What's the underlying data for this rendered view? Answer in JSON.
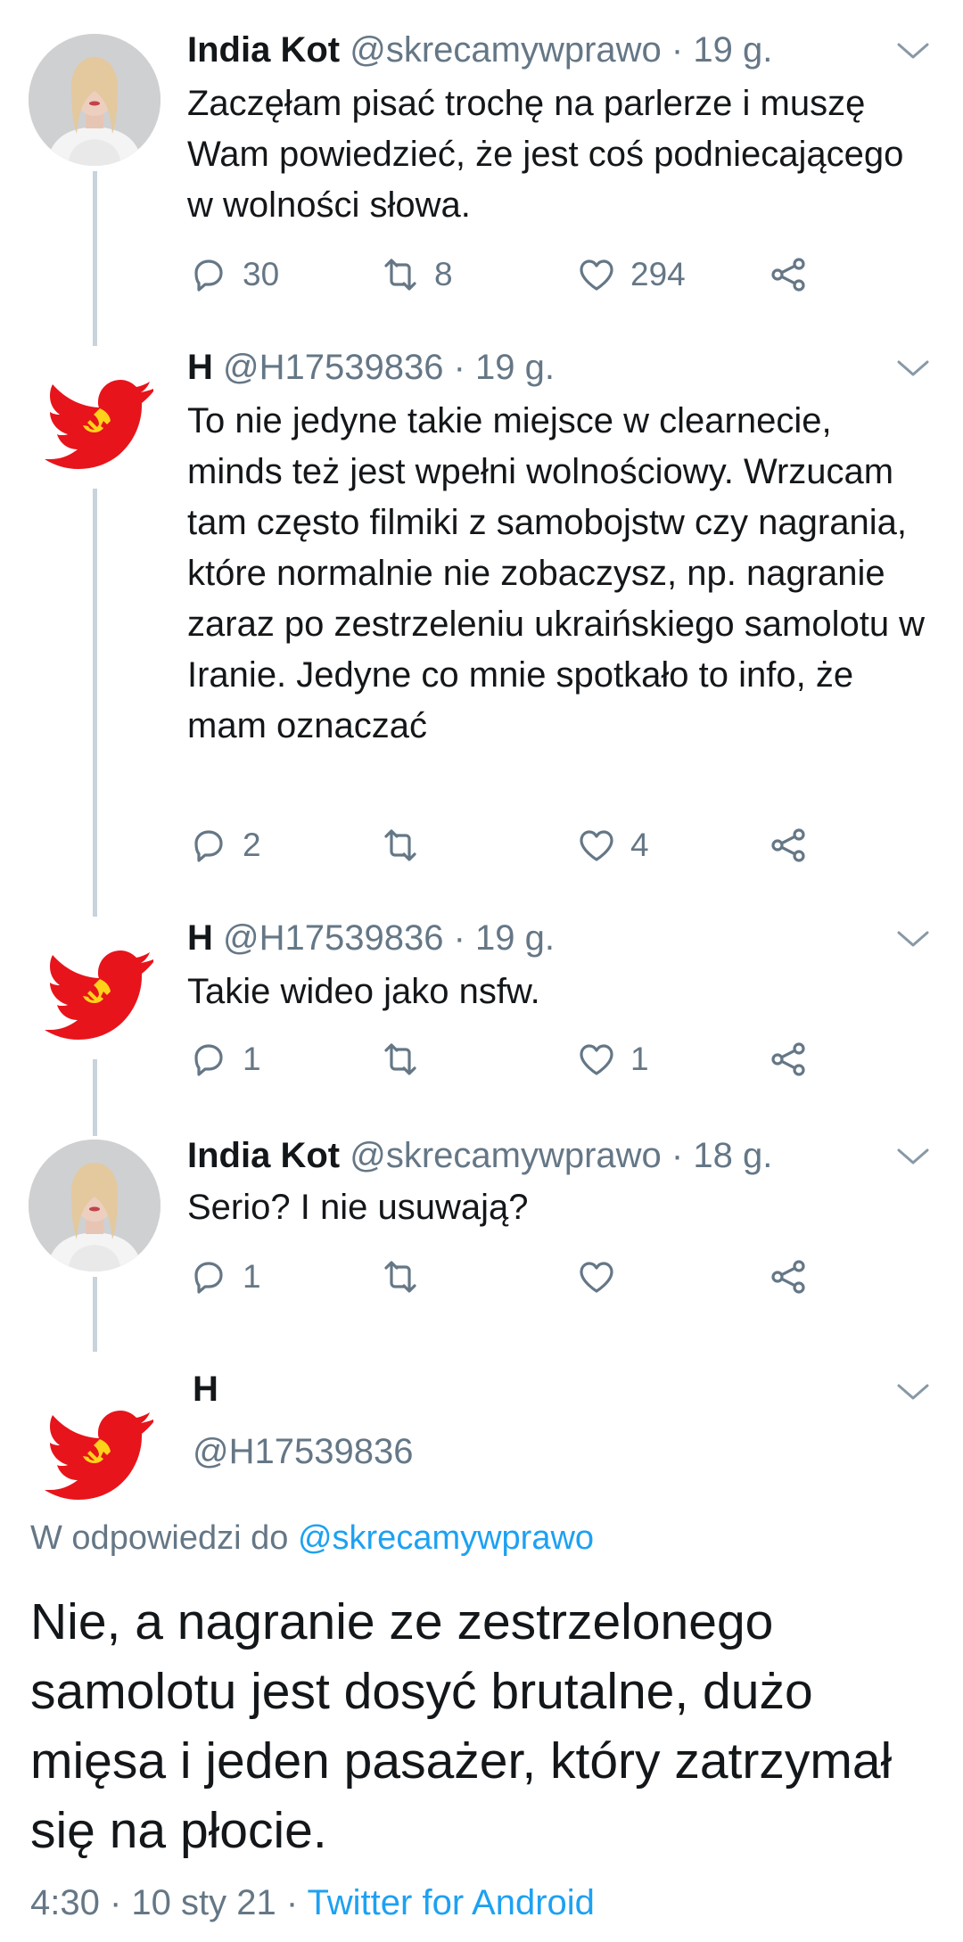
{
  "tweets": [
    {
      "name": "India Kot",
      "handle": "@skrecamywprawo",
      "time": "· 19 g.",
      "text": "Zaczęłam pisać trochę na parlerze i muszę Wam powiedzieć, że jest coś podniecającego w wolności słowa.",
      "replies": "30",
      "retweets": "8",
      "likes": "294"
    },
    {
      "name": "H",
      "handle": "@H17539836",
      "time": "· 19 g.",
      "text": "To nie jedyne takie miejsce w clearnecie, minds też jest wpełni wolnościowy. Wrzucam tam często filmiki z samobojstw czy nagrania, które normalnie nie zobaczysz, np. nagranie zaraz po zestrzeleniu ukraińskiego samolotu w Iranie. Jedyne co mnie spotkało to info, że mam oznaczać",
      "replies": "2",
      "retweets": "",
      "likes": "4"
    },
    {
      "name": "H",
      "handle": "@H17539836",
      "time": "· 19 g.",
      "text": "Takie wideo jako nsfw.",
      "replies": "1",
      "retweets": "",
      "likes": "1"
    },
    {
      "name": "India Kot",
      "handle": "@skrecamywprawo",
      "time": "· 18 g.",
      "text": "Serio? I nie usuwają?",
      "replies": "1",
      "retweets": "",
      "likes": ""
    }
  ],
  "focus": {
    "name": "H",
    "handle": "@H17539836",
    "reply_prefix": "W odpowiedzi do",
    "reply_to": "@skrecamywprawo",
    "text": "Nie, a nagranie ze zestrzelonego samolotu jest dosyć brutalne, dużo mięsa i jeden pasażer, który zatrzymał się na płocie.",
    "time": "4:30 · 10 sty 21 ·",
    "client": "Twitter for Android"
  },
  "colors": {
    "accent": "#1da1f2",
    "secondary_text": "#657786",
    "thread_line": "#c8d3dc",
    "bird_red": "#e8141b"
  }
}
